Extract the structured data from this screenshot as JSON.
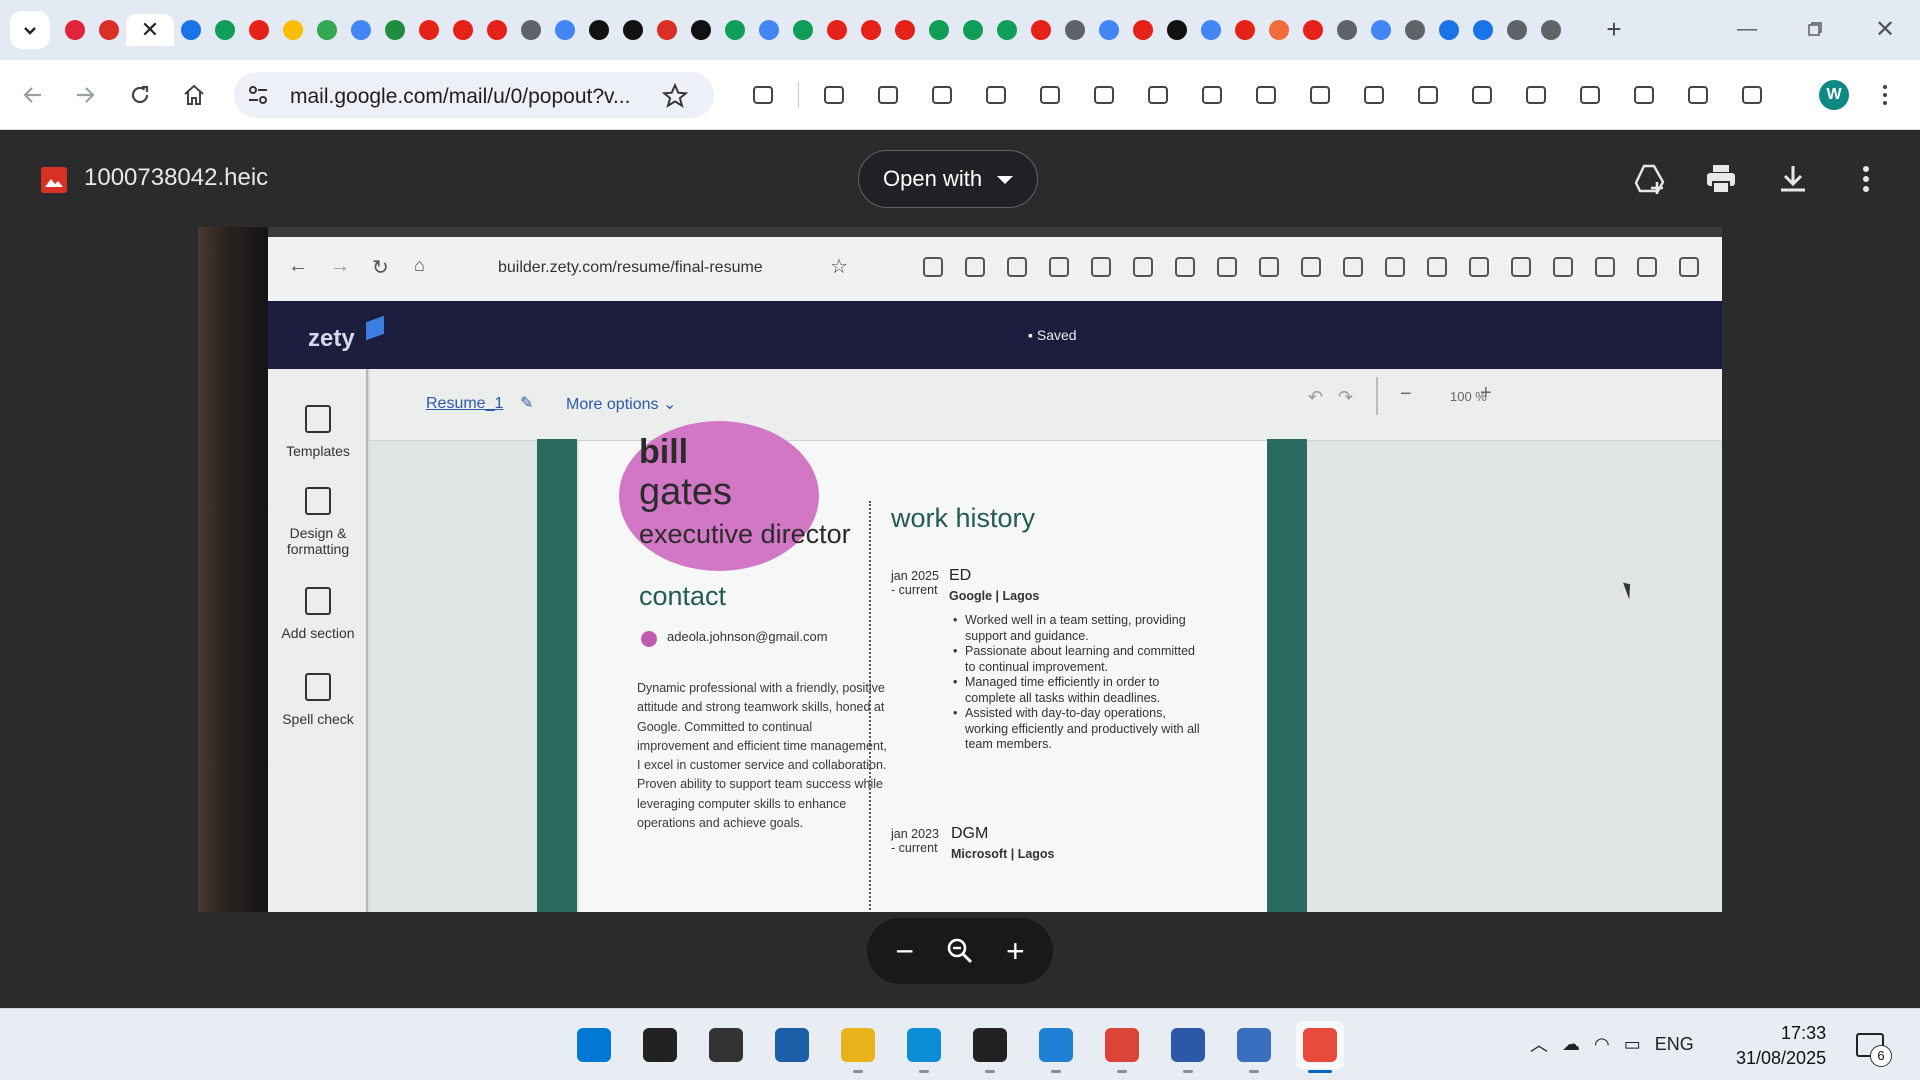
{
  "browser": {
    "tabs": [
      {
        "icon": "opera-icon",
        "color": "#e0243a"
      },
      {
        "icon": "gmail-icon",
        "color": "#d93025"
      },
      {
        "icon": "close-icon",
        "color": "#222222",
        "active": true
      },
      {
        "icon": "opera-circle-icon",
        "color": "#1a73e8"
      },
      {
        "icon": "leaf-icon",
        "color": "#0f9d58"
      },
      {
        "icon": "youtube-icon",
        "color": "#e62117"
      },
      {
        "icon": "drive-icon",
        "color": "#fbbc04"
      },
      {
        "icon": "drive-icon",
        "color": "#34a853"
      },
      {
        "icon": "google-icon",
        "color": "#4285f4"
      },
      {
        "icon": "drive-icon",
        "color": "#1e8e3e"
      },
      {
        "icon": "youtube-icon",
        "color": "#e62117"
      },
      {
        "icon": "youtube-icon",
        "color": "#e62117"
      },
      {
        "icon": "youtube-icon",
        "color": "#e62117"
      },
      {
        "icon": "chrome-icon",
        "color": "#5f6368"
      },
      {
        "icon": "google-icon",
        "color": "#4285f4"
      },
      {
        "icon": "square-icon",
        "color": "#111111"
      },
      {
        "icon": "grid-icon",
        "color": "#111111"
      },
      {
        "icon": "gmail-icon",
        "color": "#d93025"
      },
      {
        "icon": "p-icon",
        "color": "#111111"
      },
      {
        "icon": "leaf-icon",
        "color": "#0f9d58"
      },
      {
        "icon": "google-icon",
        "color": "#4285f4"
      },
      {
        "icon": "leaf-icon",
        "color": "#0f9d58"
      },
      {
        "icon": "youtube-icon",
        "color": "#e62117"
      },
      {
        "icon": "youtube-icon",
        "color": "#e62117"
      },
      {
        "icon": "youtube-icon",
        "color": "#e62117"
      },
      {
        "icon": "leaf-icon",
        "color": "#0f9d58"
      },
      {
        "icon": "leaf-icon",
        "color": "#0f9d58"
      },
      {
        "icon": "leaf-icon",
        "color": "#0f9d58"
      },
      {
        "icon": "youtube-icon",
        "color": "#e62117"
      },
      {
        "icon": "chrome-icon",
        "color": "#5f6368"
      },
      {
        "icon": "google-icon",
        "color": "#4285f4"
      },
      {
        "icon": "youtube-icon",
        "color": "#e62117"
      },
      {
        "icon": "triangle-icon",
        "color": "#111111"
      },
      {
        "icon": "google-icon",
        "color": "#4285f4"
      },
      {
        "icon": "youtube-icon",
        "color": "#e62117"
      },
      {
        "icon": "swirl-icon",
        "color": "#f26b3a"
      },
      {
        "icon": "youtube-icon",
        "color": "#e62117"
      },
      {
        "icon": "chrome-icon",
        "color": "#5f6368"
      },
      {
        "icon": "key-icon",
        "color": "#4285f4"
      },
      {
        "icon": "globe-icon",
        "color": "#5f6368"
      },
      {
        "icon": "pin-icon",
        "color": "#1a73e8"
      },
      {
        "icon": "pin-icon",
        "color": "#1a73e8"
      },
      {
        "icon": "chrome-icon",
        "color": "#5f6368"
      },
      {
        "icon": "globe-icon",
        "color": "#5f6368"
      }
    ],
    "new_tab_label": "+",
    "url": "mail.google.com/mail/u/0/popout?v...",
    "profile_initial": "W",
    "toolbar_icons": [
      "extensions-icon",
      "download-icon",
      "history-icon",
      "incognito-icon",
      "password-key-icon",
      "payment-card-icon",
      "location-pin-icon",
      "bookmarks-star-icon",
      "reading-list-icon",
      "trash-icon",
      "print-icon",
      "screenshot-icon",
      "translate-icon",
      "qr-code-icon",
      "reader-mode-icon",
      "link-icon",
      "devices-icon",
      "table-icon",
      "code-icon"
    ]
  },
  "viewer": {
    "file_name": "1000738042.heic",
    "open_with_label": "Open with",
    "accent": "#d93025"
  },
  "photo": {
    "inner_url": "builder.zety.com/resume/final-resume",
    "brand": "zety",
    "saved_label": "Saved",
    "sidebar": [
      {
        "label": "Templates",
        "icon": "document-icon"
      },
      {
        "label": "Design & formatting",
        "icon": "paint-brush-icon"
      },
      {
        "label": "Add section",
        "icon": "edit-icon"
      },
      {
        "label": "Spell check",
        "icon": "spell-check-icon"
      }
    ],
    "resume_link": "Resume_1",
    "more_options": "More options",
    "zoom_level": "100 %",
    "resume": {
      "name_line1": "bill",
      "name_line2": "gates",
      "role": "executive director",
      "contact_heading": "contact",
      "email": "adeola.johnson@gmail.com",
      "summary": "Dynamic professional with a friendly, positive attitude and strong teamwork skills, honed at Google. Committed to continual improvement and efficient time management, I excel in customer service and collaboration. Proven ability to support team success while leveraging computer skills to enhance operations and achieve goals.",
      "work_heading": "work history",
      "jobs": [
        {
          "date_line1": "jan 2025",
          "date_line2": "- current",
          "title": "ED",
          "company": "Google | Lagos",
          "bullets": [
            "Worked well in a team setting, providing support and guidance.",
            "Passionate about learning and committed to continual improvement.",
            "Managed time efficiently in order to complete all tasks within deadlines.",
            "Assisted with day-to-day operations, working efficiently and productively with all team members."
          ]
        },
        {
          "date_line1": "jan 2023",
          "date_line2": "- current",
          "title": "DGM",
          "company": "Microsoft | Lagos"
        }
      ],
      "accent": "#245b55",
      "blob_color": "#d277c6"
    }
  },
  "taskbar": {
    "apps": [
      "windows-start-icon",
      "search-icon",
      "task-view-icon",
      "widgets-icon",
      "file-explorer-icon",
      "edge-icon",
      "terminal-icon",
      "vscode-icon",
      "chrome-icon",
      "powershell-icon",
      "remote-desktop-icon",
      "app-active-icon"
    ],
    "tray_language": "ENG",
    "time": "17:33",
    "date": "31/08/2025",
    "notification_count": "6"
  }
}
